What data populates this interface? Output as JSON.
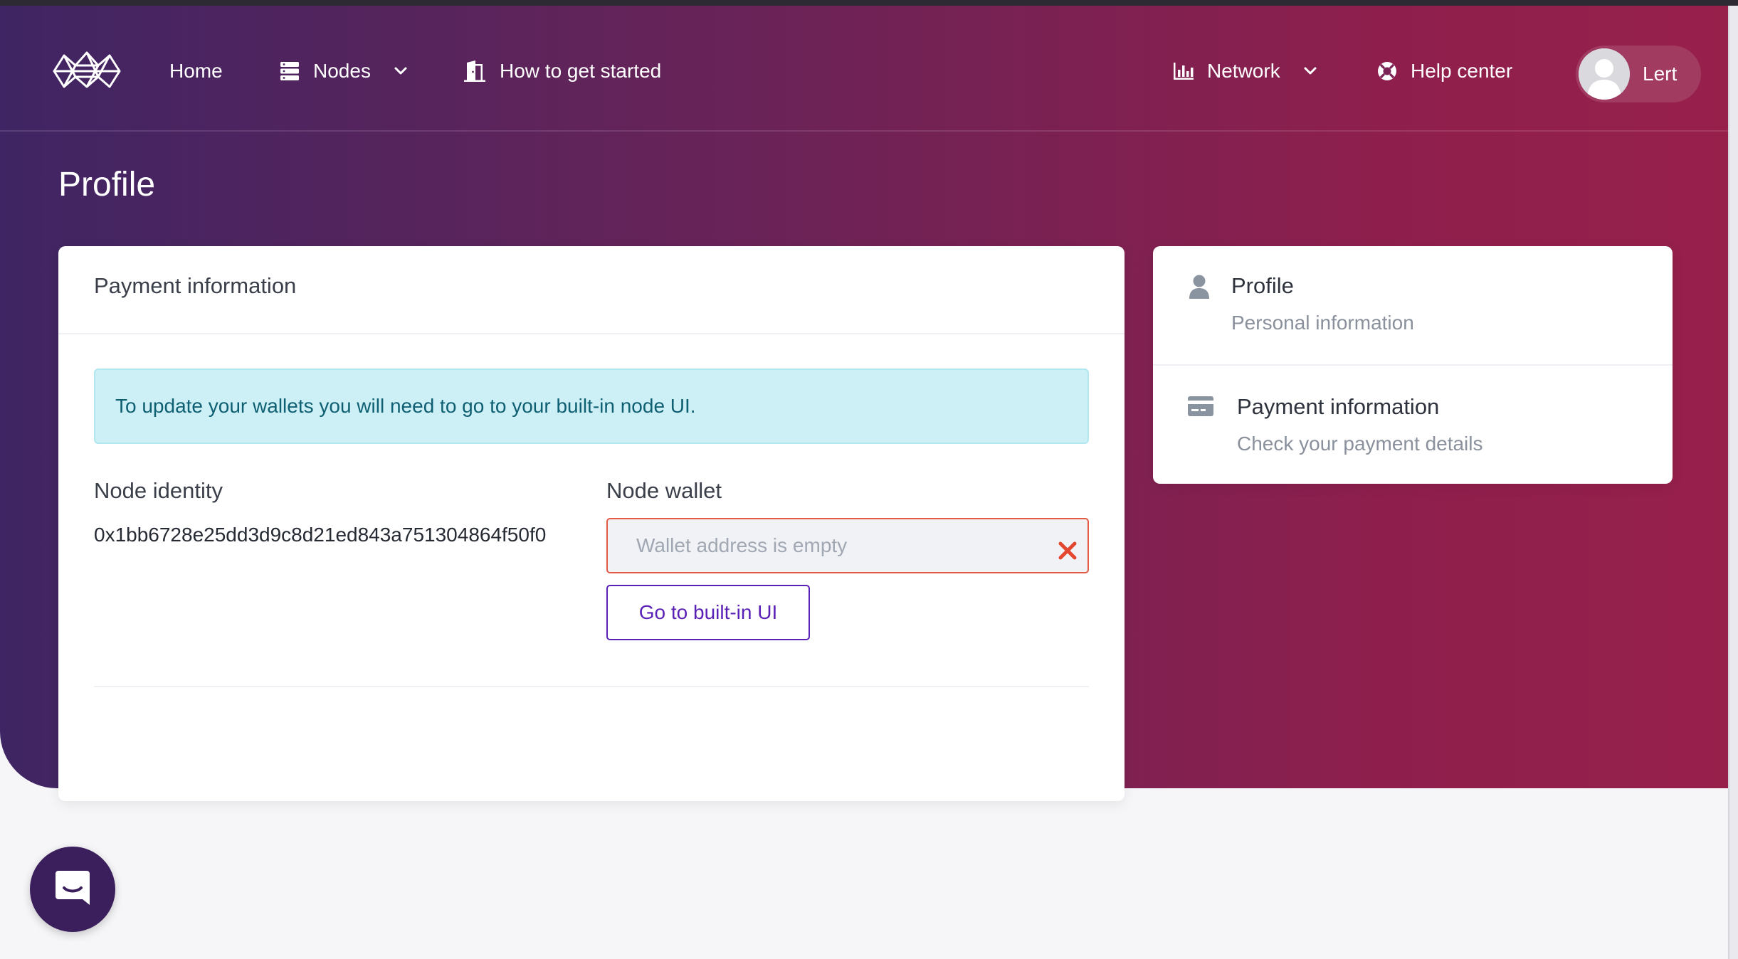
{
  "nav": {
    "home": "Home",
    "nodes": "Nodes",
    "get_started": "How to get started",
    "network": "Network",
    "help": "Help center",
    "user_name": "Lert"
  },
  "page": {
    "title": "Profile"
  },
  "payment_card": {
    "header": "Payment information",
    "alert": "To update your wallets you will need to go to your built-in node UI.",
    "identity_label": "Node identity",
    "identity_value": "0x1bb6728e25dd3d9c8d21ed843a751304864f50f0",
    "wallet_label": "Node wallet",
    "wallet_placeholder": "Wallet address is empty",
    "wallet_value": "",
    "goto_button": "Go to built-in UI"
  },
  "side_menu": {
    "items": [
      {
        "title": "Profile",
        "subtitle": "Personal information",
        "icon": "user-icon"
      },
      {
        "title": "Payment information",
        "subtitle": "Check your payment details",
        "icon": "credit-card-icon"
      }
    ]
  },
  "colors": {
    "gradient_start": "#3f2563",
    "gradient_end": "#97204b",
    "accent": "#5b21b6",
    "error": "#e35a45",
    "alert_bg": "#cdf0f6"
  }
}
